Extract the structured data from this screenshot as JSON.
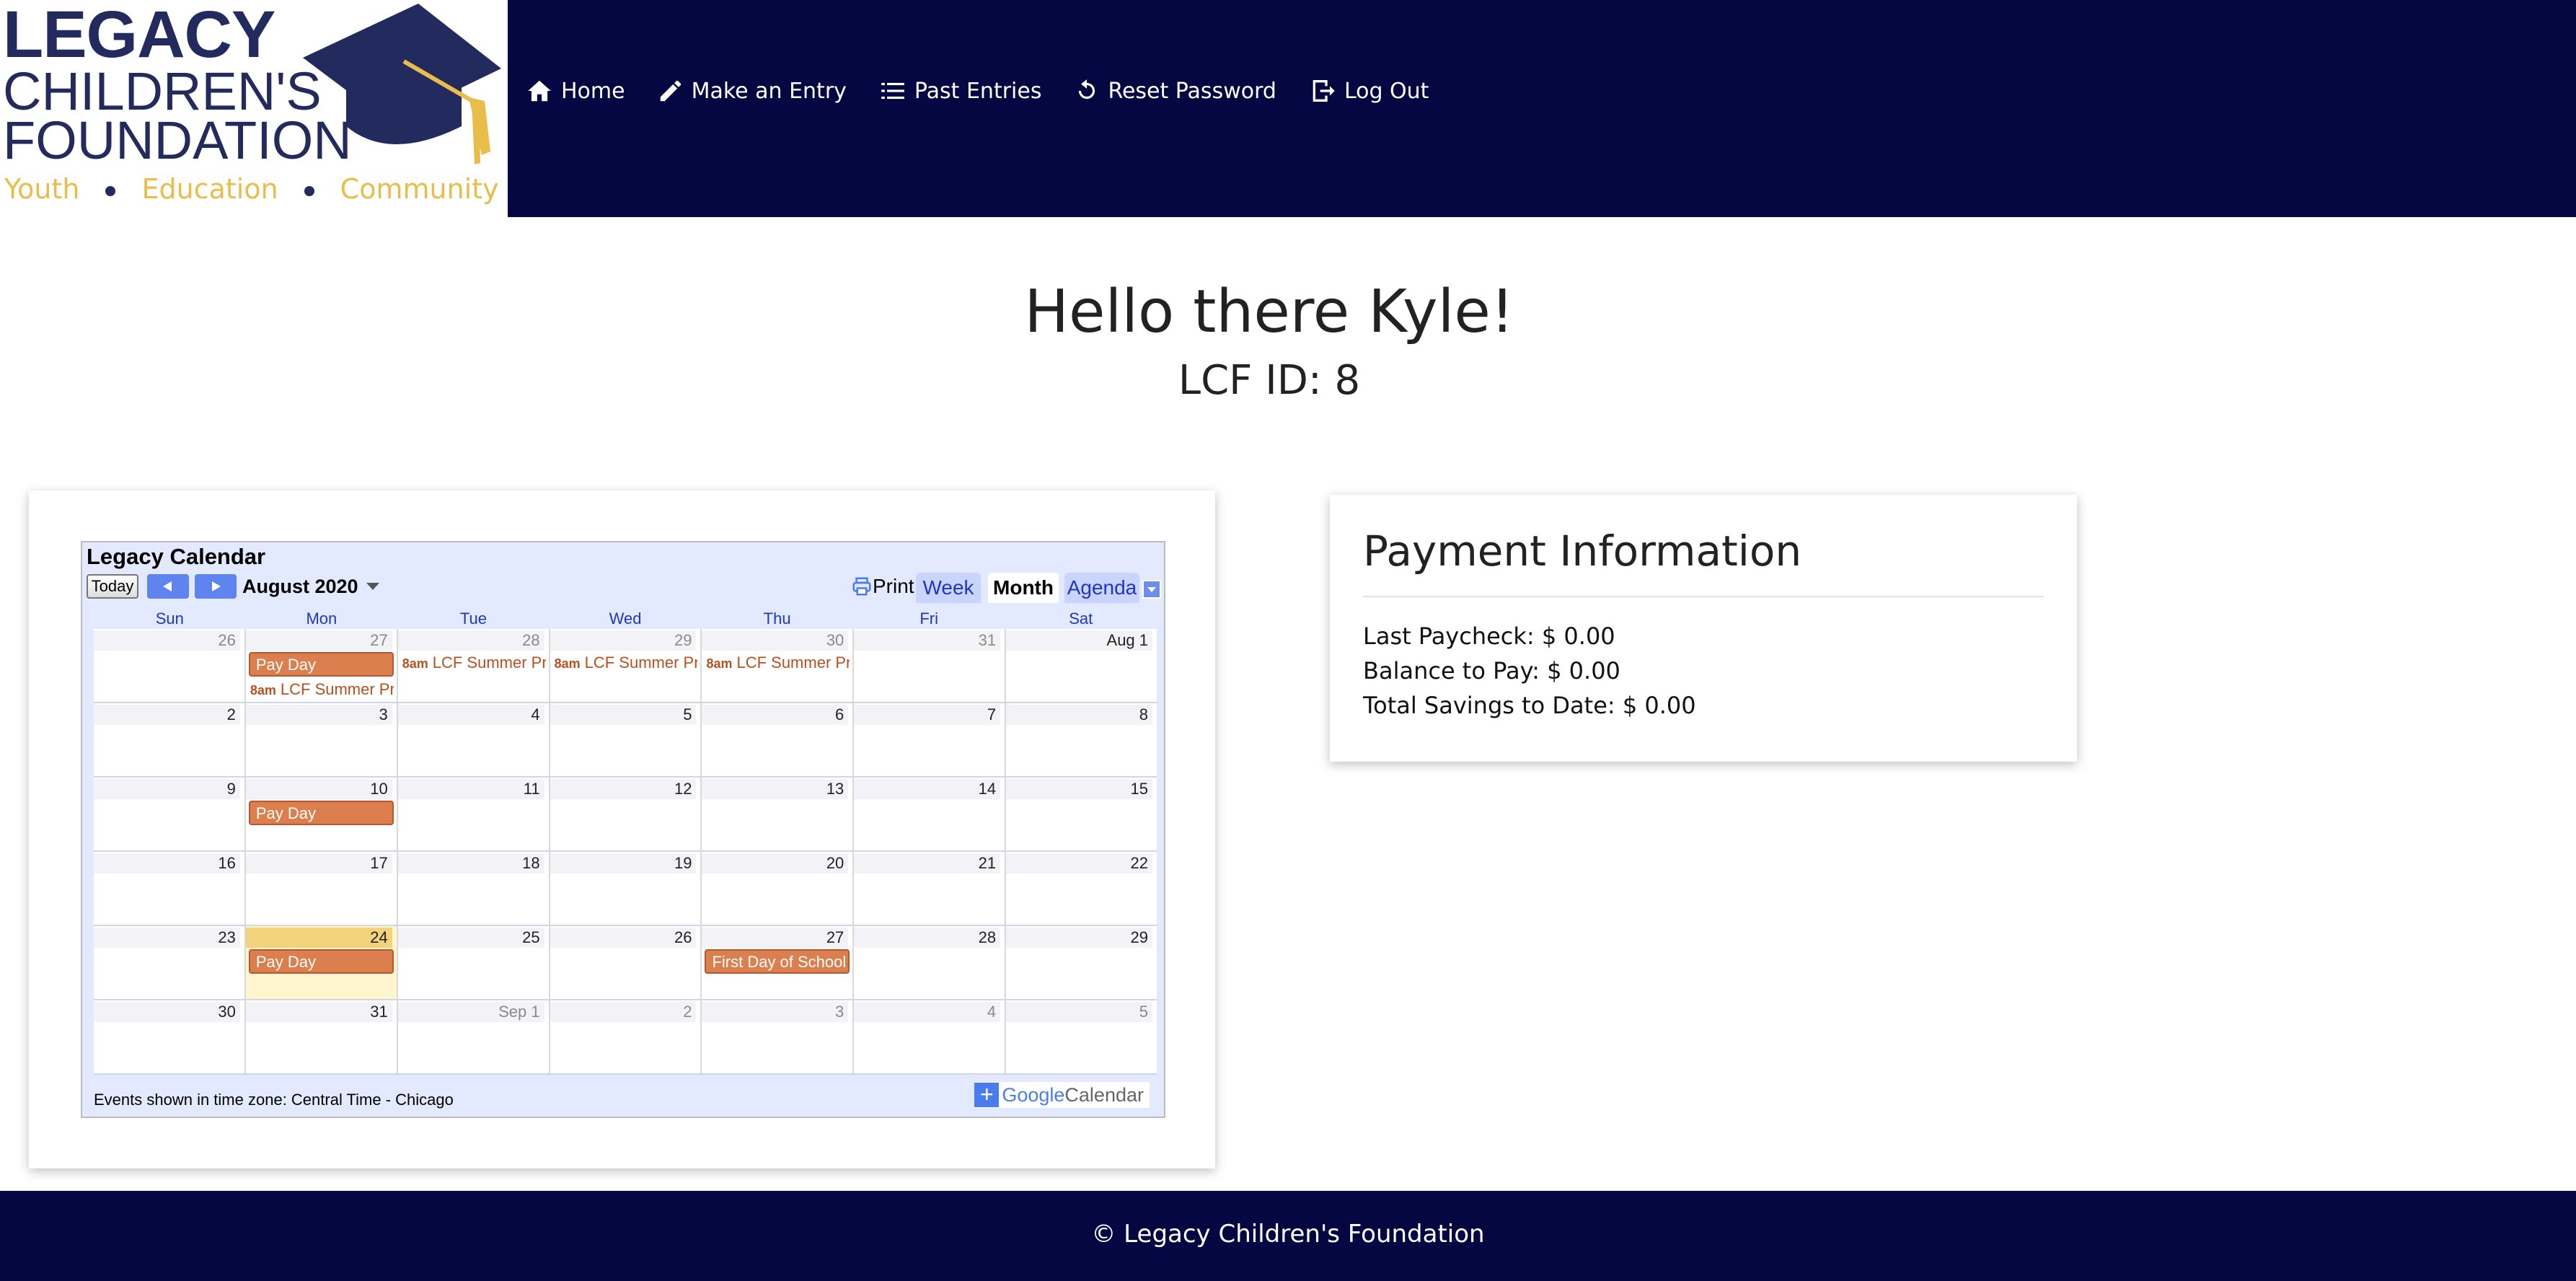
{
  "logo": {
    "line1": "LEGACY",
    "line2": "CHILDREN'S",
    "line3": "FOUNDATION",
    "tagline": [
      "Youth",
      "Education",
      "Community"
    ],
    "colors": {
      "navy": "#222a5e",
      "gold": "#e8bd4a"
    }
  },
  "nav": {
    "items": [
      {
        "label": "Home",
        "icon": "home-icon"
      },
      {
        "label": "Make an Entry",
        "icon": "pencil-icon"
      },
      {
        "label": "Past Entries",
        "icon": "list-icon"
      },
      {
        "label": "Reset Password",
        "icon": "reset-icon"
      },
      {
        "label": "Log Out",
        "icon": "logout-icon"
      }
    ]
  },
  "greeting": "Hello there Kyle!",
  "lcf_id": "LCF ID: 8",
  "calendar": {
    "title": "Legacy Calendar",
    "today_label": "Today",
    "month_label": "August 2020",
    "print_label": "Print",
    "tabs": {
      "week": "Week",
      "month": "Month",
      "agenda": "Agenda"
    },
    "days_of_week": [
      "Sun",
      "Mon",
      "Tue",
      "Wed",
      "Thu",
      "Fri",
      "Sat"
    ],
    "weeks": [
      {
        "days": [
          "26",
          "27",
          "28",
          "29",
          "30",
          "31",
          "Aug 1"
        ]
      },
      {
        "days": [
          "2",
          "3",
          "4",
          "5",
          "6",
          "7",
          "8"
        ]
      },
      {
        "days": [
          "9",
          "10",
          "11",
          "12",
          "13",
          "14",
          "15"
        ]
      },
      {
        "days": [
          "16",
          "17",
          "18",
          "19",
          "20",
          "21",
          "22"
        ]
      },
      {
        "days": [
          "23",
          "24",
          "25",
          "26",
          "27",
          "28",
          "29"
        ]
      },
      {
        "days": [
          "30",
          "31",
          "Sep 1",
          "2",
          "3",
          "4",
          "5"
        ]
      }
    ],
    "events": {
      "pay_day": "Pay Day",
      "summer_time": "8am",
      "summer_title": "LCF Summer Program",
      "first_day": "First Day of School"
    },
    "footer": "Events shown in time zone: Central Time - Chicago",
    "badge_google": "Google",
    "badge_calendar": "Calendar"
  },
  "payment": {
    "title": "Payment Information",
    "last_paycheck": "Last Paycheck: $ 0.00",
    "balance": "Balance to Pay: $ 0.00",
    "savings": "Total Savings to Date: $ 0.00"
  },
  "footer": "© Legacy Children's Foundation",
  "theme": {
    "header_bg": "#050742",
    "event_color": "#dc7f4e"
  }
}
